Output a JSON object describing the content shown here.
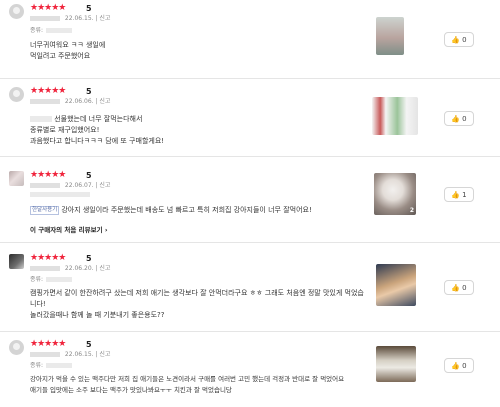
{
  "reviews": [
    {
      "stars": "★★★★★",
      "score": "5",
      "date": "22.06.15.",
      "report": "신고",
      "option_label": "종류:",
      "lines": [
        "너무귀여워요 ㅋㅋ 생일에",
        "먹일려고 주문했어요"
      ],
      "likes": "0"
    },
    {
      "stars": "★★★★★",
      "score": "5",
      "date": "22.06.06.",
      "report": "신고",
      "lines": [
        "선물했는데 너무 잘먹는다해서",
        "종류별로 재구입했어요!",
        "과음했다고 합니다ㅋㅋㅋ 담에 또 구매할게요!"
      ],
      "likes": "0"
    },
    {
      "stars": "★★★★★",
      "score": "5",
      "date": "22.06.07.",
      "report": "신고",
      "tag": "한달사용기",
      "lines": [
        "강아지 생일이라 주문했는데 배송도 넘 빠르고 특히 저희집 강아지들이 너무 잘먹어요!"
      ],
      "history_link": "이 구매자의 처음 리뷰보기",
      "photo_count": "2",
      "likes": "1"
    },
    {
      "stars": "★★★★★",
      "score": "5",
      "date": "22.06.20.",
      "report": "신고",
      "option_label": "종류:",
      "lines": [
        "캠핑가면서 같이 한잔하려구 샀는데 저희 애기는 생각보다 잘 안먹더라구요 ㅎㅎ 그래도 처음엔 정말 맛있게 먹었습",
        "니다!",
        "놀러갔을때나 함께 놀 때 기분내기 좋은용도??"
      ],
      "likes": "0"
    },
    {
      "stars": "★★★★★",
      "score": "5",
      "date": "22.06.15.",
      "report": "신고",
      "option_label": "종류:",
      "lines": [
        "강아지가 먹을 수 있는 맥주다만 저희 집 애기들은 노견이라서 구매를 여러번 고민 했는데 걱정과 반대로 잘 먹었어요",
        "애기들 입맛에는 소주 보다는 맥주가 맛있나봐요ㅜㅜ 치킨과 잘 먹었습니당"
      ],
      "likes": "0"
    }
  ],
  "like_icon": "thumbs-up-icon",
  "colors": {
    "star": "#f0243c",
    "border": "#e5e5e5"
  }
}
